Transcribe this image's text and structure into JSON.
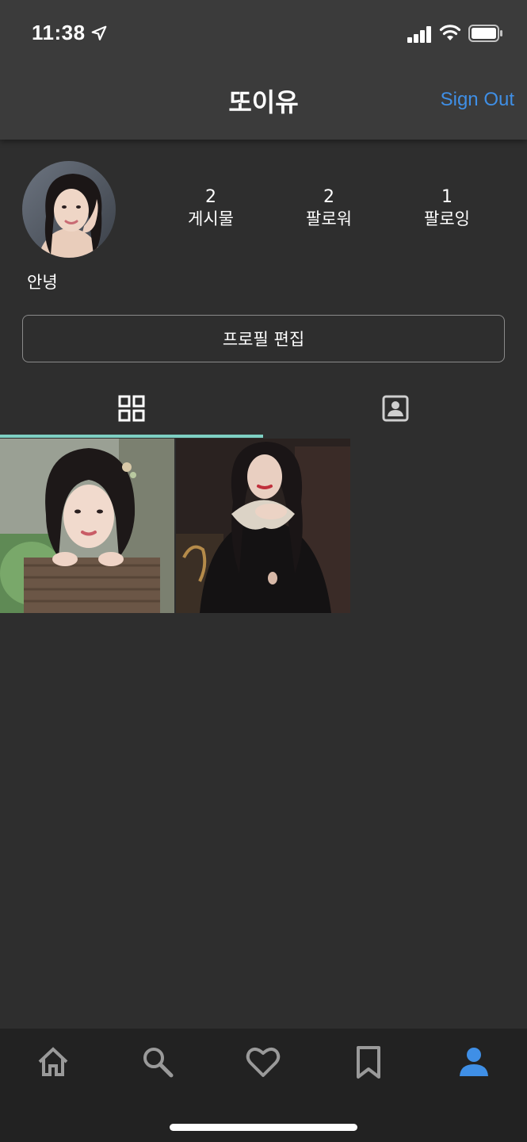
{
  "status_bar": {
    "time": "11:38"
  },
  "header": {
    "title": "또이유",
    "sign_out_label": "Sign Out"
  },
  "profile": {
    "username": "안녕",
    "stats": [
      {
        "value": "2",
        "label": "게시물"
      },
      {
        "value": "2",
        "label": "팔로워"
      },
      {
        "value": "1",
        "label": "팔로잉"
      }
    ],
    "edit_button_label": "프로필 편집"
  },
  "tabs": [
    {
      "icon": "grid-icon",
      "active": true
    },
    {
      "icon": "portrait-icon",
      "active": false
    }
  ],
  "posts_visible": 2,
  "bottom_nav": [
    {
      "icon": "home-icon",
      "active": false
    },
    {
      "icon": "search-icon",
      "active": false
    },
    {
      "icon": "heart-icon",
      "active": false
    },
    {
      "icon": "bookmark-icon",
      "active": false
    },
    {
      "icon": "person-icon",
      "active": true
    }
  ],
  "colors": {
    "background": "#2e2e2e",
    "header": "#3b3b3b",
    "accent_blue": "#3f8fe6",
    "tab_indicator": "#7ed0c3",
    "inactive_icon": "#9a9a9a",
    "bottom_nav": "#222222"
  }
}
